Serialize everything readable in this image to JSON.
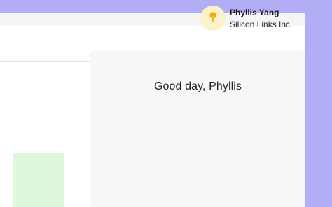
{
  "user": {
    "name": "Phyllis Yang",
    "company": "Silicon Links Inc",
    "avatar_icon": "lightbulb-icon",
    "avatar_color": "#f5a800"
  },
  "main": {
    "greeting": "Good day, Phyllis"
  },
  "colors": {
    "background": "#b2aef6",
    "panel": "#f7f7f8",
    "preview_tile": "#dcf9dc"
  }
}
